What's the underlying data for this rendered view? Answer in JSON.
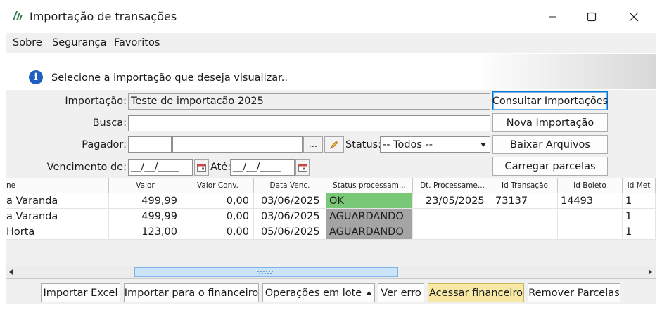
{
  "window": {
    "title": "Importação de transações",
    "logo_icon": "app-logo-icon",
    "controls": [
      "minimize-icon",
      "maximize-icon",
      "close-icon"
    ]
  },
  "menu": {
    "items": [
      "Sobre",
      "Segurança",
      "Favoritos"
    ]
  },
  "info": {
    "icon": "info-icon",
    "icon_glyph": "i",
    "message": "Selecione a importação que deseja visualizar.."
  },
  "form": {
    "importacao_label": "Importação:",
    "importacao_value": "Teste de importacão 2025",
    "busca_label": "Busca:",
    "busca_value": "",
    "pagador_label": "Pagador:",
    "pagador_code": "",
    "pagador_name": "",
    "pagador_lookup_label": "...",
    "status_label": "Status:",
    "status_value": "-- Todos --",
    "vencimento_label": "Vencimento de:",
    "vencimento_de": "__/__/____",
    "ate_label": "Até:",
    "vencimento_ate": "__/__/____"
  },
  "side_buttons": {
    "consultar": "Consultar Importações",
    "nova": "Nova Importação",
    "baixar": "Baixar Arquivos",
    "carregar": "Carregar parcelas"
  },
  "grid": {
    "columns": [
      "ne",
      "Valor",
      "Valor Conv.",
      "Data Venc.",
      "Status processam...",
      "Dt. Processame...",
      "Id Transação",
      "Id Boleto",
      "Id Met"
    ],
    "rows": [
      {
        "nome": "a Varanda",
        "valor": "499,99",
        "valor_conv": "0,00",
        "data_venc": "03/06/2025",
        "status": "OK",
        "dt_proc": "23/05/2025",
        "id_transacao": "73137",
        "id_boleto": "14493",
        "id_met": "1"
      },
      {
        "nome": "a Varanda",
        "valor": "499,99",
        "valor_conv": "0,00",
        "data_venc": "03/06/2025",
        "status": "AGUARDANDO",
        "dt_proc": "",
        "id_transacao": "",
        "id_boleto": "",
        "id_met": "1"
      },
      {
        "nome": "Horta",
        "valor": "123,00",
        "valor_conv": "0,00",
        "data_venc": "05/06/2025",
        "status": "AGUARDANDO",
        "dt_proc": "",
        "id_transacao": "",
        "id_boleto": "",
        "id_met": "1"
      }
    ],
    "status_colors": {
      "OK": "#78c878",
      "AGUARDANDO": "#a4a4a4"
    }
  },
  "toolbar": {
    "importar_excel": "Importar Excel",
    "importar_financeiro": "Importar para o financeiro",
    "operacoes_lote": "Operações em lote",
    "ver_erro": "Ver erro",
    "acessar_financeiro": "Acessar financeiro",
    "remover_parcelas": "Remover Parcelas"
  },
  "colors": {
    "focus_border": "#0078d7",
    "accent_button": "#f7e9a5",
    "scroll_thumb": "#cce4f7"
  }
}
